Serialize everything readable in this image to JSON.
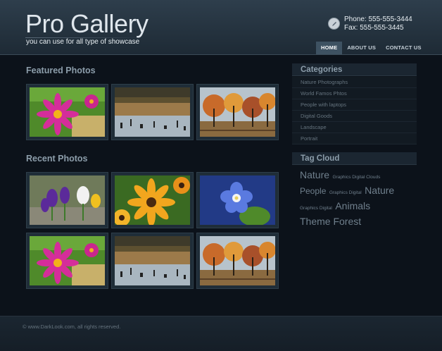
{
  "header": {
    "logo_title": "Pro Gallery",
    "tagline": "you can use for all type of showcase",
    "phone": "Phone: 555-555-3444",
    "fax": "Fax: 555-555-3445",
    "contact_icon": "pencil-icon"
  },
  "nav": {
    "items": [
      {
        "label": "HOME",
        "active": true
      },
      {
        "label": "ABOUT US",
        "active": false
      },
      {
        "label": "CONTACT US",
        "active": false
      }
    ]
  },
  "featured": {
    "title": "Featured Photos",
    "photos": [
      "pink-dahlia-photo",
      "lake-trees-photo",
      "autumn-trees-photo"
    ]
  },
  "recent": {
    "title": "Recent Photos",
    "photos": [
      "crocus-flowers-photo",
      "orange-daisies-photo",
      "blue-flower-photo",
      "pink-dahlia-photo",
      "lake-trees-photo",
      "autumn-trees-photo"
    ]
  },
  "categories": {
    "title": "Categories",
    "items": [
      "Nature Photographs",
      "World Famos Phtos",
      "People with laptops",
      "Digital Goods",
      "Landscape",
      "Portrait"
    ]
  },
  "tag_cloud": {
    "title": "Tag Cloud",
    "line1": {
      "big": "Nature",
      "small": "Graphics Digital Clouds"
    },
    "line2": {
      "big": "People",
      "small": "Graphics Digital",
      "big2": "Nature"
    },
    "line3": {
      "small": "Graphics Digital",
      "big": "Animals"
    },
    "line4": {
      "big": "Theme Forest"
    }
  },
  "footer": {
    "copyright": "© www.DarkLook.com, all rights reserved."
  },
  "colors": {
    "background": "#0c121a",
    "header": "#2e3e4c",
    "nav_active": "#3e5262",
    "heading_text": "#8c9daa"
  }
}
